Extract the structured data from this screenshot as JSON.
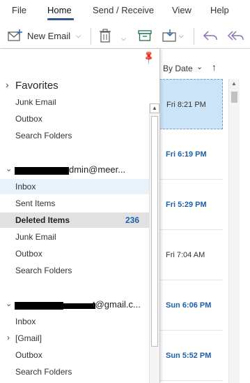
{
  "menu": {
    "tabs": [
      {
        "label": "File"
      },
      {
        "label": "Home"
      },
      {
        "label": "Send / Receive"
      },
      {
        "label": "View"
      },
      {
        "label": "Help"
      }
    ],
    "active": "Home"
  },
  "toolbar": {
    "new_email_label": "New Email"
  },
  "message_list": {
    "sort_label": "By Date",
    "rows": [
      {
        "time": "Fri 8:21 PM",
        "unread": false,
        "selected": true
      },
      {
        "time": "Fri 6:19 PM",
        "unread": true,
        "selected": false
      },
      {
        "time": "Fri 5:29 PM",
        "unread": true,
        "selected": false
      },
      {
        "time": "Fri 7:04 AM",
        "unread": false,
        "selected": false
      },
      {
        "time": "Sun 6:06 PM",
        "unread": true,
        "selected": false
      },
      {
        "time": "Sun 5:52 PM",
        "unread": true,
        "selected": false
      }
    ]
  },
  "folder_pane": {
    "favorites_label": "Favorites",
    "top_folders": [
      "Junk Email",
      "Outbox",
      "Search Folders"
    ],
    "accounts": [
      {
        "label_visible": "dmin@meer...",
        "folders": [
          {
            "name": "Inbox"
          },
          {
            "name": "Sent Items"
          },
          {
            "name": "Deleted Items",
            "count": "236"
          },
          {
            "name": "Junk Email"
          },
          {
            "name": "Outbox"
          },
          {
            "name": "Search Folders"
          }
        ]
      },
      {
        "label_visible": "t@gmail.c...",
        "folders": [
          {
            "name": "Inbox"
          },
          {
            "name": "[Gmail]"
          },
          {
            "name": "Outbox"
          },
          {
            "name": "Search Folders"
          }
        ]
      }
    ]
  },
  "colors": {
    "accent": "#2f5597",
    "unread_time": "#1f5fa8",
    "selected_row": "#cce4f7",
    "hover_folder": "#e8f2fb",
    "selected_folder": "#e1e1e1",
    "icon_blue": "#2e6db4",
    "icon_green": "#217346",
    "icon_purple": "#8a6fb8"
  }
}
